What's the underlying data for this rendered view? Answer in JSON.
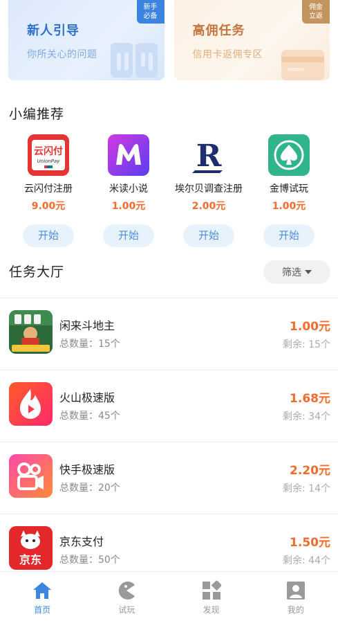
{
  "promos": [
    {
      "title": "新人引导",
      "subtitle": "你所关心的问题",
      "badge_line1": "新手",
      "badge_line2": "必备"
    },
    {
      "title": "高佣任务",
      "subtitle": "信用卡返佣专区",
      "badge_line1": "佣金",
      "badge_line2": "立返"
    }
  ],
  "recommend": {
    "title": "小编推荐",
    "items": [
      {
        "name": "云闪付注册",
        "price": "9.00元",
        "button": "开始",
        "icon": "unionpay-icon",
        "icon_text": "云闪付",
        "icon_sub": "UnionPay"
      },
      {
        "name": "米读小说",
        "price": "1.00元",
        "button": "开始",
        "icon": "midu-m-icon"
      },
      {
        "name": "埃尔贝调查注册",
        "price": "2.00元",
        "button": "开始",
        "icon": "letter-r-icon",
        "icon_text": "R"
      },
      {
        "name": "金博试玩",
        "price": "1.00元",
        "button": "开始",
        "icon": "spade-icon"
      }
    ]
  },
  "tasks": {
    "title": "任务大厅",
    "filter_label": "筛选",
    "items": [
      {
        "name": "闲来斗地主",
        "total": "总数量：15个",
        "price": "1.00元",
        "remain": "剩余: 15个",
        "icon": "card-game-icon"
      },
      {
        "name": "火山极速版",
        "total": "总数量：45个",
        "price": "1.68元",
        "remain": "剩余: 34个",
        "icon": "flame-icon"
      },
      {
        "name": "快手极速版",
        "total": "总数量：20个",
        "price": "2.20元",
        "remain": "剩余: 14个",
        "icon": "video-camera-icon"
      },
      {
        "name": "京东支付",
        "total": "总数量：50个",
        "price": "1.50元",
        "remain": "剩余: 44个",
        "icon": "jd-dog-icon",
        "icon_text": "京东"
      }
    ]
  },
  "nav": [
    {
      "label": "首页",
      "icon": "home-icon",
      "active": true
    },
    {
      "label": "试玩",
      "icon": "pacman-icon",
      "active": false
    },
    {
      "label": "发现",
      "icon": "grid-icon",
      "active": false
    },
    {
      "label": "我的",
      "icon": "user-icon",
      "active": false
    }
  ],
  "colors": {
    "accent": "#3b86e0",
    "price": "#f06b2c",
    "button_bg": "#e8f2fc"
  }
}
